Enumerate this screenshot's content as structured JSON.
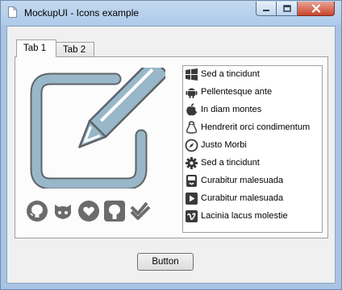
{
  "window": {
    "title": "MockupUI - Icons example"
  },
  "tabs": [
    {
      "label": "Tab 1",
      "selected": true
    },
    {
      "label": "Tab 2",
      "selected": false
    }
  ],
  "big_icon": {
    "name": "edit-icon"
  },
  "small_icons": [
    "github-icon",
    "github-alt-icon",
    "gittip-icon",
    "github-square-icon",
    "foursquare-icon"
  ],
  "list": {
    "items": [
      {
        "icon": "windows-icon",
        "label": "Sed a tincidunt"
      },
      {
        "icon": "android-icon",
        "label": "Pellentesque ante"
      },
      {
        "icon": "apple-icon",
        "label": "In diam montes"
      },
      {
        "icon": "linux-icon",
        "label": "Hendrerit orci condimentum"
      },
      {
        "icon": "compass-icon",
        "label": "Justo Morbi"
      },
      {
        "icon": "gear-icon",
        "label": "Sed a tincidunt"
      },
      {
        "icon": "trello-icon",
        "label": "Curabitur malesuada"
      },
      {
        "icon": "play-icon",
        "label": "Curabitur malesuada"
      },
      {
        "icon": "vimeo-icon",
        "label": "Lacinia lacus molestie"
      }
    ]
  },
  "button": {
    "label": "Button"
  },
  "colors": {
    "icon_fill": "#98b7c9",
    "icon_stroke": "#5f6368",
    "icon_dark": "#6b6b6b",
    "list_icon": "#3a3a3a",
    "close_button": "#c9452c"
  }
}
